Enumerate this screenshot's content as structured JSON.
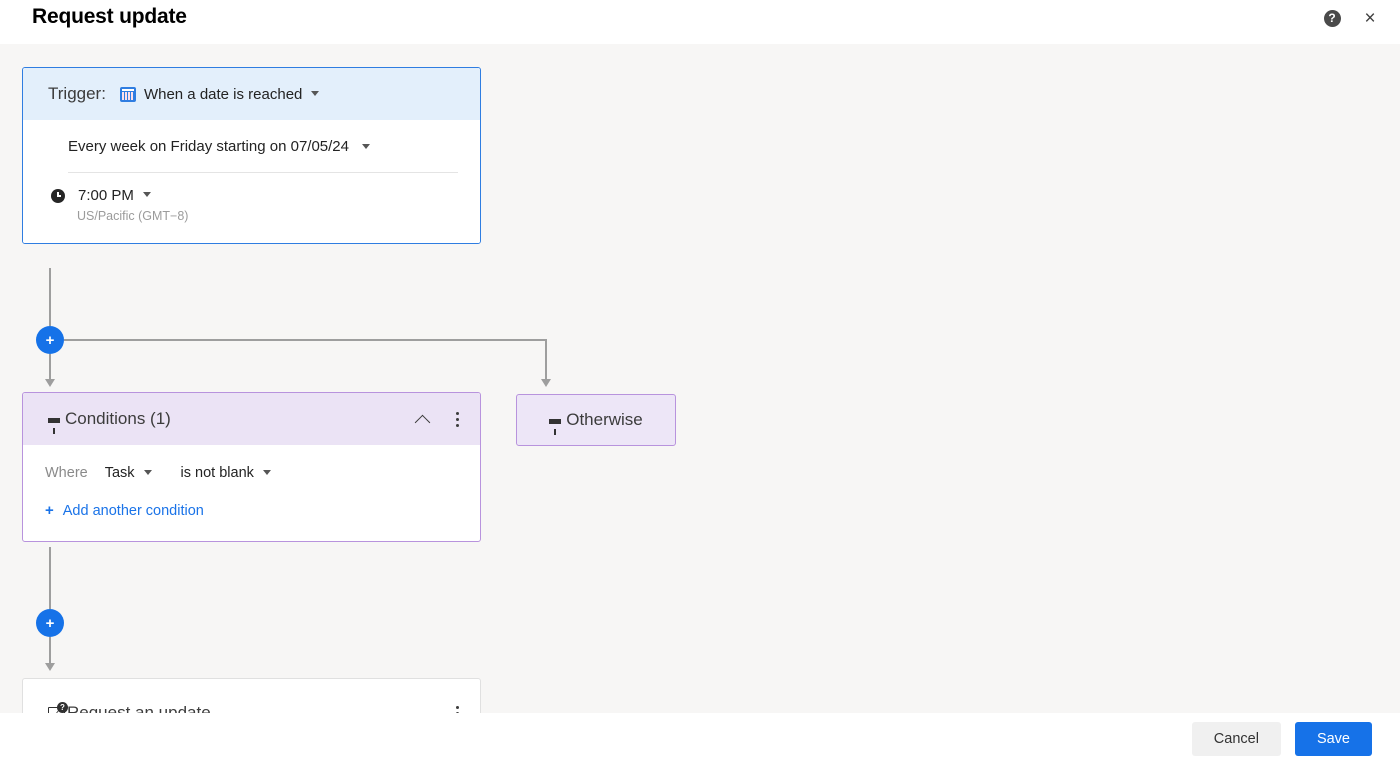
{
  "header": {
    "title": "Request update",
    "help_icon": "help-circle-icon",
    "help_glyph": "?",
    "close_icon": "close-icon",
    "close_glyph": "×"
  },
  "trigger": {
    "label": "Trigger:",
    "type_value": "When a date is reached",
    "type_icon": "calendar-icon",
    "recurrence": "Every week on Friday starting on 07/05/24",
    "time_icon": "clock-icon",
    "time_value": "7:00 PM",
    "timezone": "US/Pacific (GMT−8)",
    "accent_color": "#2f7de1",
    "header_bg": "#e3effb"
  },
  "branch": {
    "add_node_glyph": "+",
    "add_node_top_name": "add-step-after-trigger",
    "add_node_bottom_name": "add-step-after-conditions"
  },
  "conditions": {
    "title": "Conditions (1)",
    "filter_icon": "filter-icon",
    "collapse_icon": "chevron-up-icon",
    "menu_icon": "kebab-menu-icon",
    "where_label": "Where",
    "field_value": "Task",
    "operator_value": "is not blank",
    "add_condition_label": "Add another condition",
    "add_condition_glyph": "+",
    "accent_color": "#b893dd",
    "header_bg": "#ebe3f5"
  },
  "otherwise": {
    "label": "Otherwise",
    "filter_icon": "filter-icon",
    "bg": "#ede6f7",
    "border": "#b893dd"
  },
  "action": {
    "title": "Request an update",
    "icon": "mail-question-icon",
    "badge_glyph": "?",
    "menu_icon": "kebab-menu-icon"
  },
  "footer": {
    "cancel_label": "Cancel",
    "save_label": "Save",
    "save_color": "#1672e8"
  }
}
